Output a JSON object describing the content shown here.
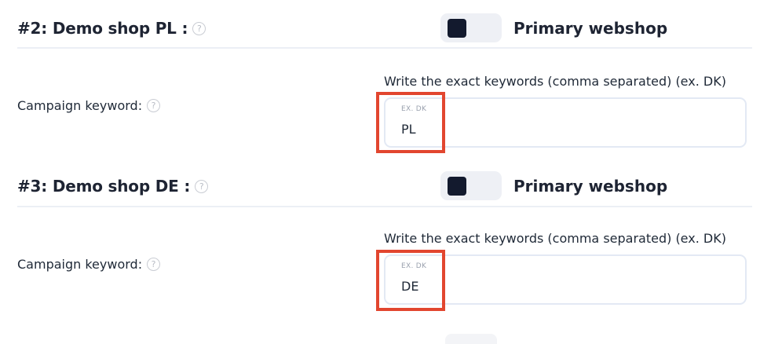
{
  "shops": [
    {
      "title": "#2: Demo shop PL :",
      "help_glyph": "?",
      "toggle_label": "Primary webshop",
      "field_label": "Campaign keyword:",
      "hint": "Write the exact keywords (comma separated) (ex. DK)",
      "input_label": "EX. DK",
      "input_value": "PL",
      "highlighted": true
    },
    {
      "title": "#3: Demo shop DE :",
      "help_glyph": "?",
      "toggle_label": "Primary webshop",
      "field_label": "Campaign keyword:",
      "hint": "Write the exact keywords (comma separated) (ex. DK)",
      "input_label": "EX. DK",
      "input_value": "DE",
      "highlighted": true
    }
  ],
  "colors": {
    "highlight": "#e2462f",
    "toggle_knob": "#131a2e",
    "toggle_track": "#eef0f5",
    "input_border": "#e3e9f4"
  },
  "icons": {
    "help": "question-circle-icon"
  }
}
